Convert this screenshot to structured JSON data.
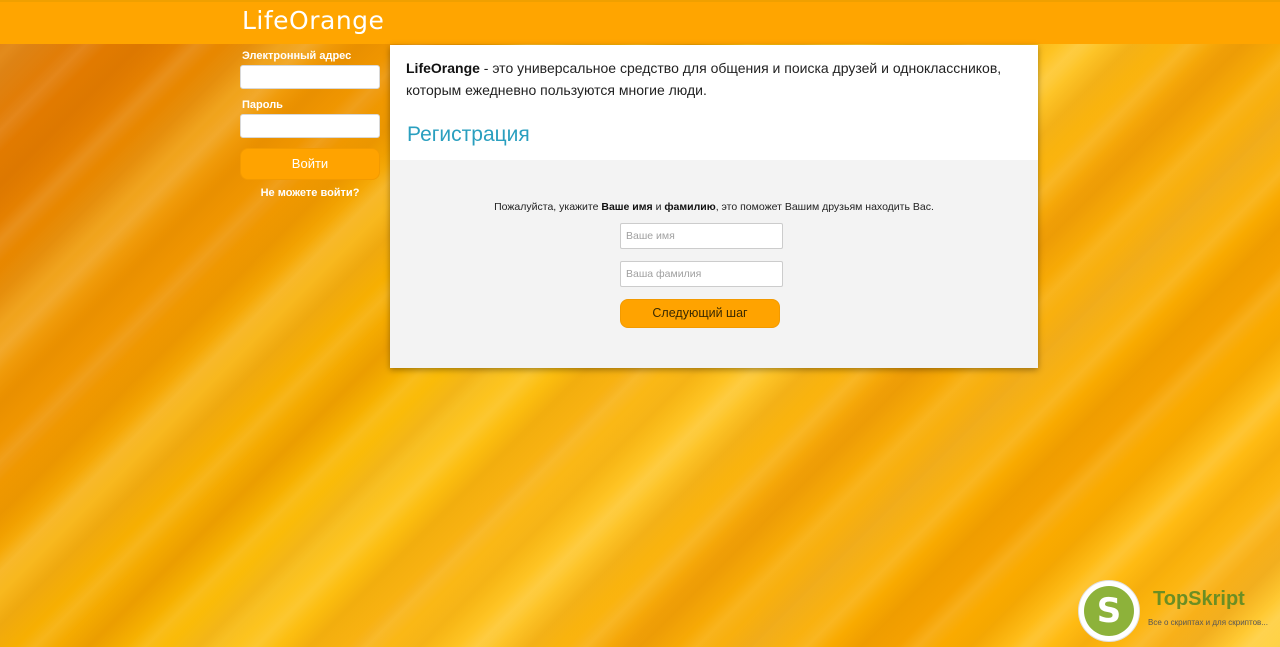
{
  "header": {
    "logo": "LifeOrange"
  },
  "login": {
    "email_label": "Электронный адрес",
    "email_value": "",
    "password_label": "Пароль",
    "password_value": "",
    "submit_label": "Войти",
    "forgot_label": "Не можете войти?"
  },
  "intro": {
    "brand": "LifeOrange",
    "text": " - это универсальное средство для общения и поиска друзей и одноклассников, которым ежедневно пользуются многие люди."
  },
  "registration": {
    "title": "Регистрация",
    "prompt_before": "Пожалуйста, укажите ",
    "prompt_name": "Ваше имя",
    "prompt_and": " и ",
    "prompt_surname": "фамилию",
    "prompt_after": ", это поможет Вашим друзьям находить Вас.",
    "first_name_placeholder": "Ваше имя",
    "last_name_placeholder": "Ваша фамилия",
    "next_label": "Следующий шаг"
  },
  "watermark": {
    "letter": "S",
    "name": "TopSkript",
    "tagline": "Все о скриптах и для скриптов..."
  },
  "colors": {
    "accent": "#ffa500",
    "title_blue": "#2a9fbf",
    "watermark_green": "#8db23a"
  }
}
